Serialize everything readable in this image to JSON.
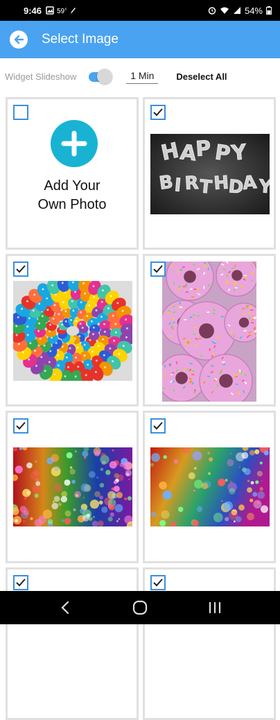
{
  "status": {
    "time": "9:46",
    "battery": "54%"
  },
  "appbar": {
    "title": "Select Image"
  },
  "controls": {
    "slideshow_label": "Widget Slideshow",
    "slideshow_on": true,
    "interval": "1 Min",
    "deselect_label": "Deselect All"
  },
  "grid": {
    "add_line1": "Add Your",
    "add_line2": "Own Photo",
    "balloon_letters": [
      "H",
      "A",
      "P",
      "P",
      "Y",
      "B",
      "I",
      "R",
      "T",
      "H",
      "D",
      "A",
      "Y"
    ]
  },
  "colors": {
    "accent": "#4aa3f0",
    "add": "#18b3d3",
    "checkbox": "#3a8fe0"
  }
}
